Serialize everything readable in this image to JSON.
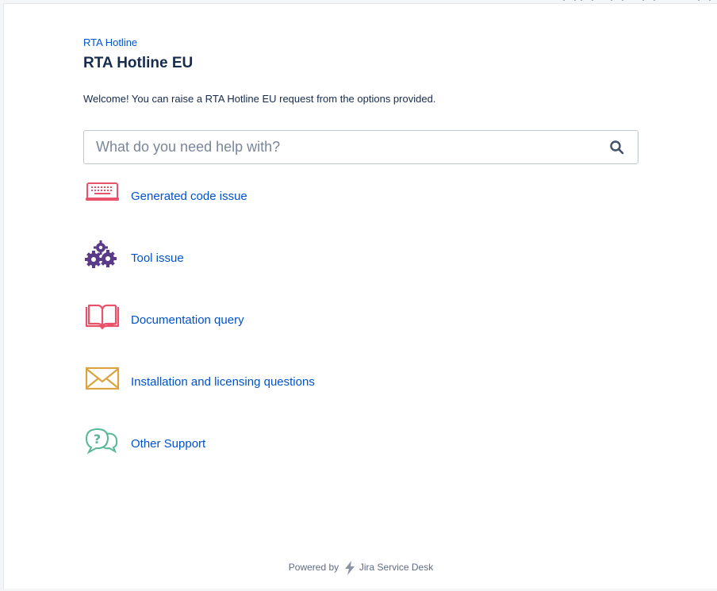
{
  "breadcrumb": {
    "label": "RTA Hotline"
  },
  "header": {
    "title": "RTA Hotline EU"
  },
  "welcome": {
    "text": "Welcome! You can raise a RTA Hotline EU request from the options provided."
  },
  "search": {
    "placeholder": "What do you need help with?",
    "value": ""
  },
  "request_types": [
    {
      "label": "Generated code issue",
      "icon": "keyboard-icon",
      "color": "#e8536b"
    },
    {
      "label": "Tool issue",
      "icon": "gears-icon",
      "color": "#5b3a87"
    },
    {
      "label": "Documentation query",
      "icon": "book-icon",
      "color": "#e8536b"
    },
    {
      "label": "Installation and licensing questions",
      "icon": "envelope-icon",
      "color": "#d9a441"
    },
    {
      "label": "Other Support",
      "icon": "question-bubbles-icon",
      "color": "#57b894"
    }
  ],
  "footer": {
    "powered_by": "Powered by",
    "product": "Jira Service Desk"
  },
  "colors": {
    "link": "#0052cc",
    "text": "#172b4d",
    "muted": "#5e6c84",
    "background": "#f4f5f7"
  }
}
